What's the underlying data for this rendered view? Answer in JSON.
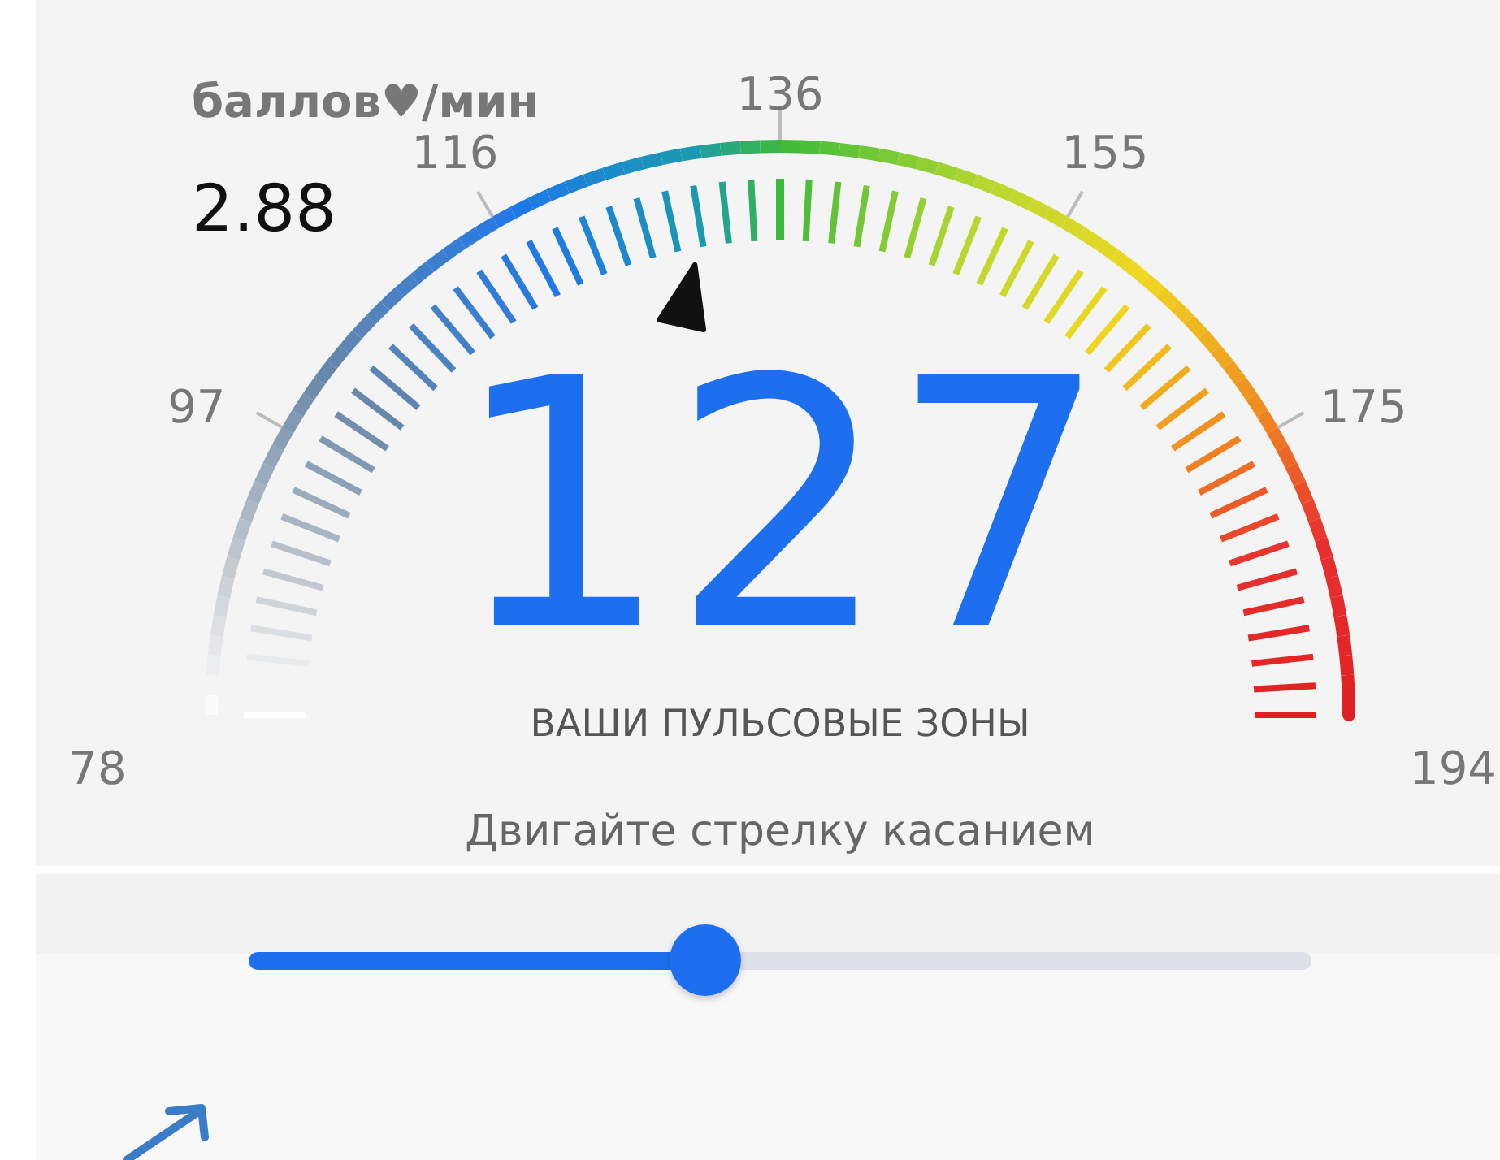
{
  "gauge": {
    "unit_label": "баллов♥/мин",
    "rate": "2.88",
    "scale_labels": [
      "78",
      "97",
      "116",
      "136",
      "155",
      "175",
      "194"
    ],
    "value": "127",
    "title": "ВАШИ ПУЛЬСОВЫЕ ЗОНЫ",
    "hint": "Двигайте стрелку касанием"
  },
  "slider": {
    "level": 0.43
  }
}
